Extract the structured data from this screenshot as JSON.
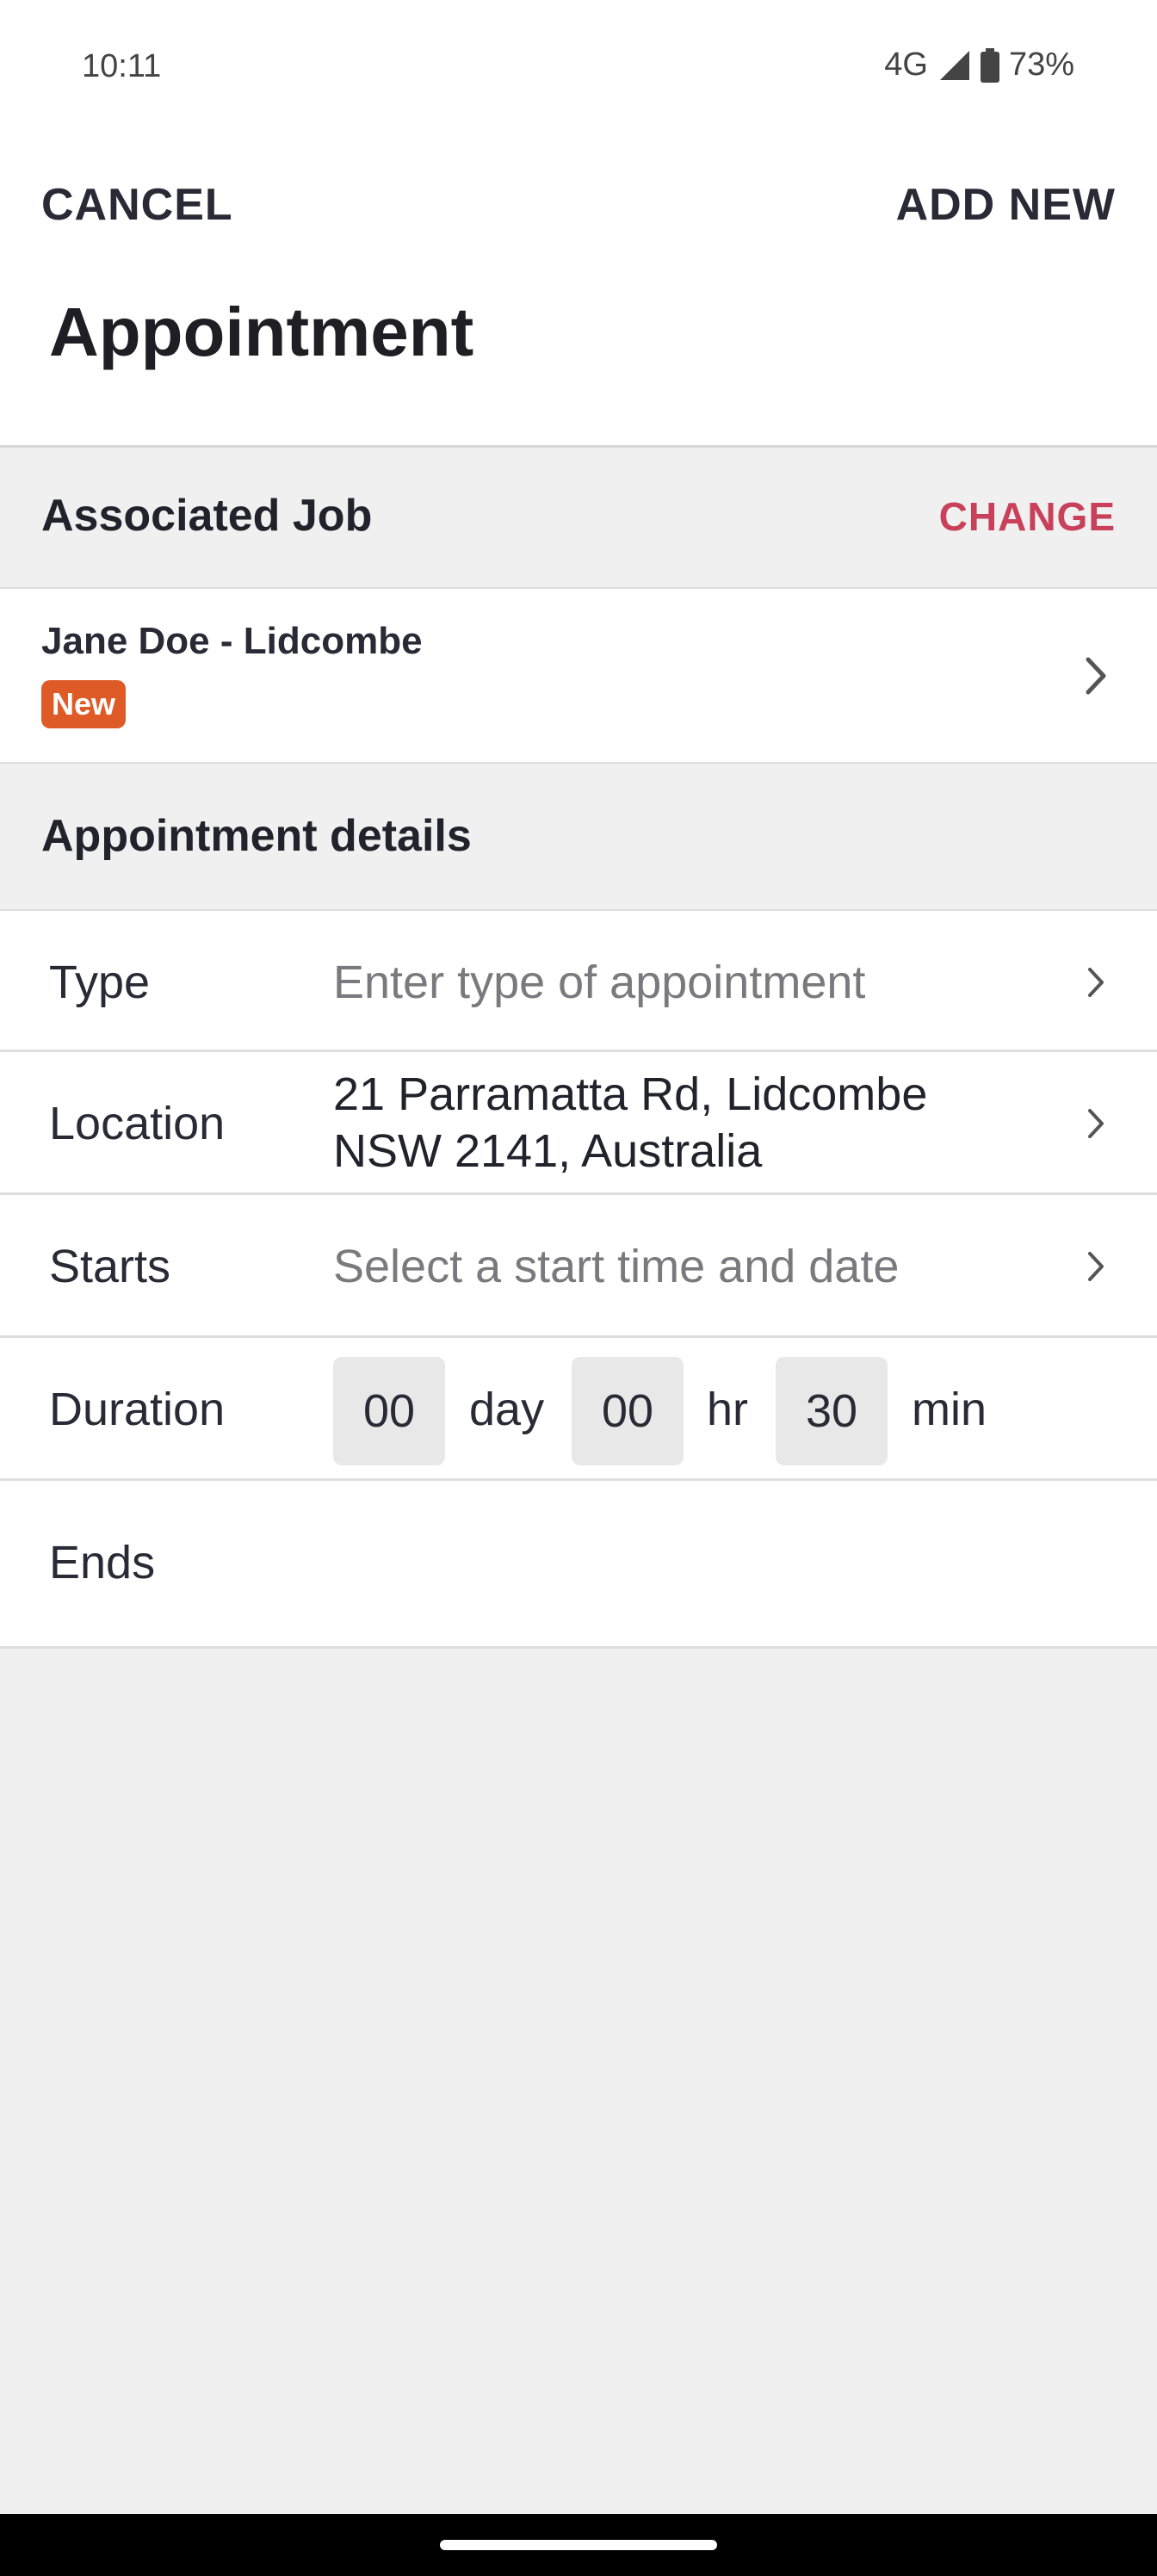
{
  "status_bar": {
    "time": "10:11",
    "network": "4G",
    "battery": "73%",
    "icons": [
      "signal-icon",
      "battery-icon"
    ]
  },
  "header": {
    "cancel_label": "CANCEL",
    "add_new_label": "ADD NEW",
    "title": "Appointment"
  },
  "associated_job": {
    "section_title": "Associated Job",
    "change_label": "CHANGE",
    "job_name": "Jane Doe - Lidcombe",
    "status_badge": "New",
    "badge_color": "#de5a26"
  },
  "details": {
    "section_title": "Appointment details",
    "type": {
      "label": "Type",
      "placeholder": "Enter type of appointment"
    },
    "location": {
      "label": "Location",
      "value_line1": "21 Parramatta Rd, Lidcombe",
      "value_line2": "NSW 2141, Australia"
    },
    "starts": {
      "label": "Starts",
      "placeholder": "Select a start time and date"
    },
    "duration": {
      "label": "Duration",
      "days": "00",
      "day_unit": "day",
      "hours": "00",
      "hour_unit": "hr",
      "minutes": "30",
      "minute_unit": "min"
    },
    "ends": {
      "label": "Ends"
    }
  },
  "colors": {
    "accent": "#c8405a",
    "background": "#f0f0f0",
    "text": "#22222c"
  }
}
